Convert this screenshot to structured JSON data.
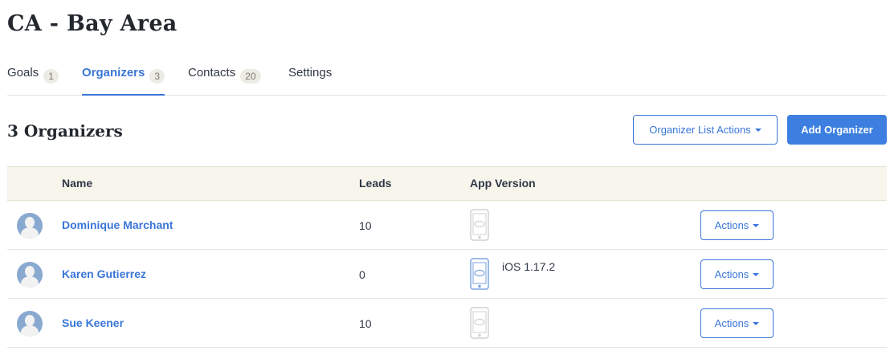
{
  "page": {
    "title": "CA - Bay Area"
  },
  "tabs": [
    {
      "label": "Goals",
      "count": "1"
    },
    {
      "label": "Organizers",
      "count": "3"
    },
    {
      "label": "Contacts",
      "count": "20"
    },
    {
      "label": "Settings"
    }
  ],
  "section": {
    "title": "3 Organizers"
  },
  "toolbar": {
    "list_actions_label": "Organizer List Actions",
    "add_label": "Add Organizer"
  },
  "table": {
    "columns": [
      "Name",
      "Leads",
      "App Version"
    ],
    "rows": [
      {
        "name": "Dominique Marchant",
        "leads": "10",
        "app_version": "",
        "app_active": false,
        "actions_label": "Actions"
      },
      {
        "name": "Karen Gutierrez",
        "leads": "0",
        "app_version": "iOS 1.17.2",
        "app_active": true,
        "actions_label": "Actions"
      },
      {
        "name": "Sue Keener",
        "leads": "10",
        "app_version": "",
        "app_active": false,
        "actions_label": "Actions"
      }
    ]
  },
  "colors": {
    "accent": "#3a76d8",
    "primary_button": "#3c7fe0",
    "header_bg": "#f7f5ec",
    "phone_inactive": "#d0d0d0",
    "phone_active": "#7aa3e0"
  }
}
